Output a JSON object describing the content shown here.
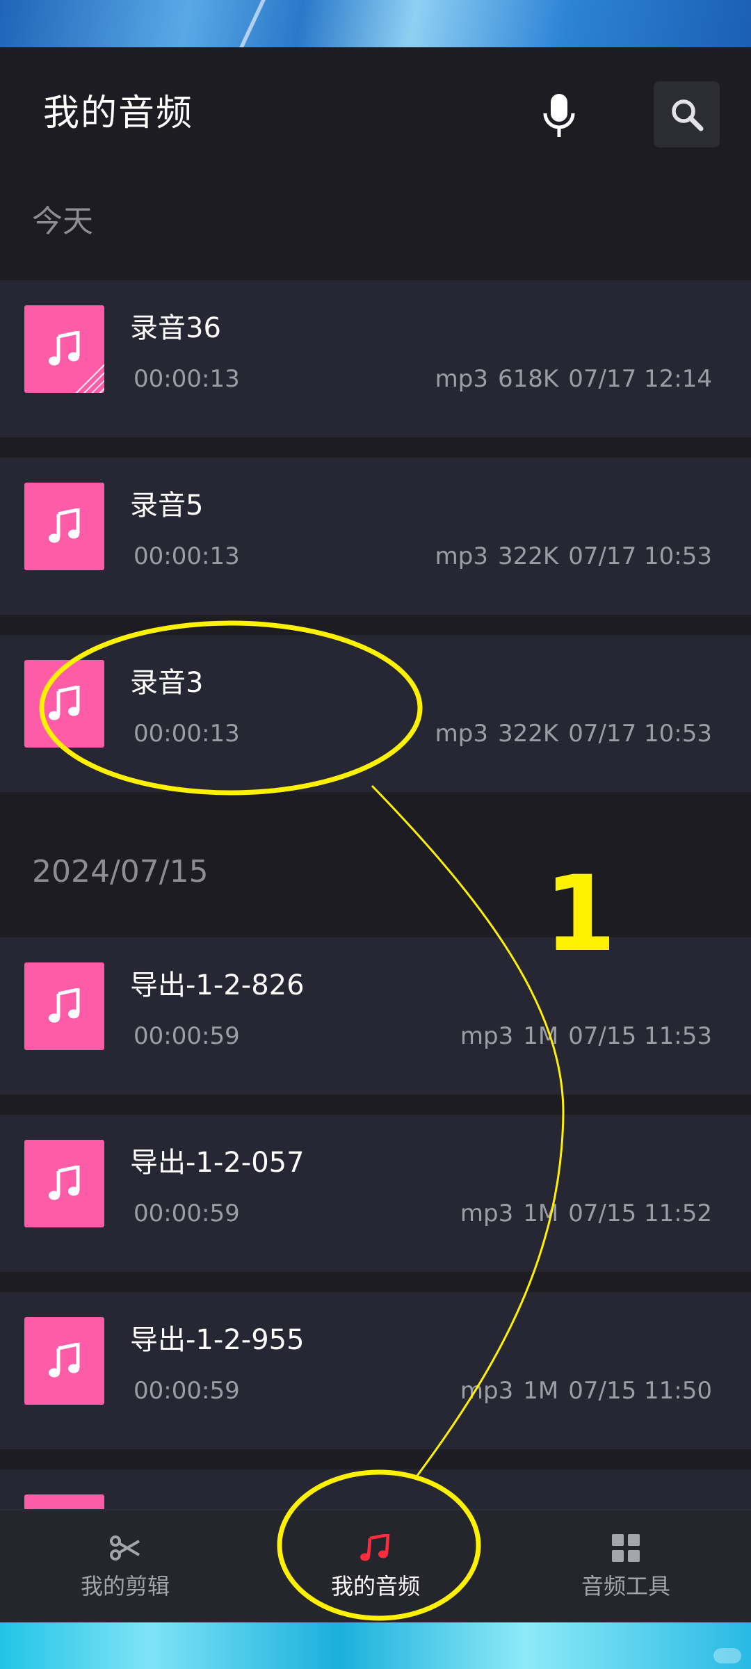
{
  "header": {
    "title": "我的音频",
    "mic_icon": "microphone-icon",
    "search_icon": "search-icon"
  },
  "sections": [
    {
      "label": "今天",
      "items": [
        {
          "name": "录音36",
          "duration": "00:00:13",
          "format": "mp3",
          "size": "618K",
          "date": "07/17 12:14"
        },
        {
          "name": "录音5",
          "duration": "00:00:13",
          "format": "mp3",
          "size": "322K",
          "date": "07/17 10:53"
        },
        {
          "name": "录音3",
          "duration": "00:00:13",
          "format": "mp3",
          "size": "322K",
          "date": "07/17 10:53"
        }
      ]
    },
    {
      "label": "2024/07/15",
      "items": [
        {
          "name": "导出-1-2-826",
          "duration": "00:00:59",
          "format": "mp3",
          "size": "1M",
          "date": "07/15 11:53"
        },
        {
          "name": "导出-1-2-057",
          "duration": "00:00:59",
          "format": "mp3",
          "size": "1M",
          "date": "07/15 11:52"
        },
        {
          "name": "导出-1-2-955",
          "duration": "00:00:59",
          "format": "mp3",
          "size": "1M",
          "date": "07/15 11:50"
        }
      ]
    }
  ],
  "bottom_nav": {
    "items": [
      {
        "label": "我的剪辑",
        "icon": "scissors-icon"
      },
      {
        "label": "我的音频",
        "icon": "music-note-icon",
        "active": true
      },
      {
        "label": "音频工具",
        "icon": "grid-icon"
      }
    ]
  },
  "annotation": {
    "number": "1",
    "color": "#fff200"
  },
  "colors": {
    "accent_pink": "#ff5ca8",
    "active_red": "#ff2d3d",
    "background": "#1c1c22",
    "row_background": "#262732"
  }
}
